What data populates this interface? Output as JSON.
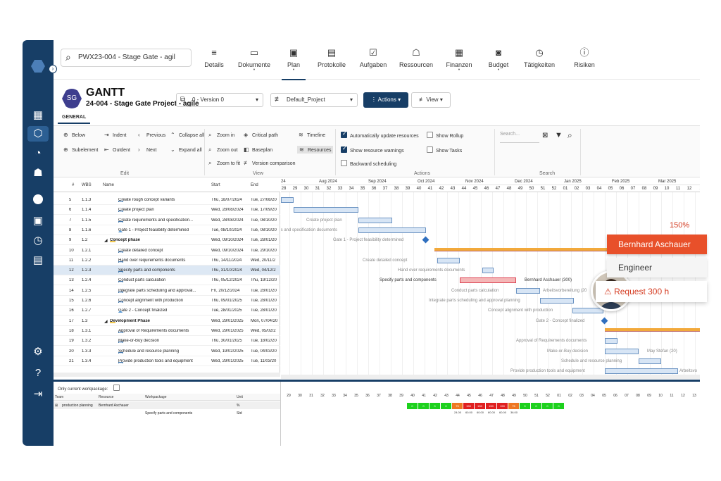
{
  "topnav": {
    "search_value": "PWX23-004 - Stage Gate - agil",
    "items": [
      {
        "label": "Details",
        "icon": "details-icon"
      },
      {
        "label": "Dokumente",
        "icon": "document-icon"
      },
      {
        "label": "Plan",
        "icon": "plan-icon"
      },
      {
        "label": "Protokolle",
        "icon": "protocol-icon"
      },
      {
        "label": "Aufgaben",
        "icon": "task-icon"
      },
      {
        "label": "Ressourcen",
        "icon": "resource-icon"
      },
      {
        "label": "Finanzen",
        "icon": "finance-icon"
      },
      {
        "label": "Budget",
        "icon": "budget-icon"
      },
      {
        "label": "Tätigkeiten",
        "icon": "timer-icon"
      },
      {
        "label": "Risiken",
        "icon": "risk-icon"
      }
    ]
  },
  "header": {
    "badge": "SG",
    "title": "GANTT",
    "subtitle": "24-004 - Stage Gate Project - agile",
    "version": "0 - Version 0",
    "profile": "Default_Project",
    "actions_label": "Actions",
    "view_label": "View",
    "tab": "GENERAL"
  },
  "ribbon": {
    "edit": {
      "below": "Below",
      "indent": "Indent",
      "subelement": "Subelement",
      "outdent": "Outdent",
      "previous": "Previous",
      "next": "Next",
      "collapse_all": "Collapse all",
      "expand_all": "Expand all",
      "group": "Edit"
    },
    "view": {
      "zoom_in": "Zoom in",
      "zoom_out": "Zoom out",
      "zoom_fit": "Zoom to fit",
      "critical_path": "Critical path",
      "baseplan": "Baseplan",
      "version_comparison": "Version comparison",
      "timeline": "Timeline",
      "resources": "Resources",
      "group": "View"
    },
    "actions": {
      "auto_update": "Automatically update resources",
      "show_warnings": "Show resource warnings",
      "backward": "Backward scheduling",
      "show_rollup": "Show Rollup",
      "show_tasks": "Show Tasks",
      "group": "Actions"
    },
    "search": {
      "placeholder": "Search...",
      "group": "Search"
    }
  },
  "grid": {
    "headers": {
      "num": "#",
      "wbs": "WBS",
      "name": "Name",
      "start": "Start",
      "end": "End"
    },
    "rows": [
      {
        "num": "5",
        "wbs": "1.1.3",
        "name": "Create rough concept variants",
        "start": "Thu, 18/07/2024",
        "end": "Tue, 27/08/20"
      },
      {
        "num": "6",
        "wbs": "1.1.4",
        "name": "Create project plan",
        "start": "Wed, 28/08/2024",
        "end": "Tue, 17/09/20"
      },
      {
        "num": "7",
        "wbs": "1.1.5",
        "name": "Create requirements and specification...",
        "start": "Wed, 28/08/2024",
        "end": "Tue, 08/10/20"
      },
      {
        "num": "8",
        "wbs": "1.1.6",
        "name": "Gate 1 - Project feasibility determined",
        "start": "Tue, 08/10/2024",
        "end": "Tue, 08/10/20"
      },
      {
        "num": "9",
        "wbs": "1.2",
        "name": "Concept phase",
        "start": "Wed, 09/10/2024",
        "end": "Tue, 28/01/20"
      },
      {
        "num": "10",
        "wbs": "1.2.1",
        "name": "Create detailed concept",
        "start": "Wed, 09/10/2024",
        "end": "Tue, 29/10/20"
      },
      {
        "num": "11",
        "wbs": "1.2.2",
        "name": "Hand over requirements documents",
        "start": "Thu, 14/11/2024",
        "end": "Wed, 20/11/2"
      },
      {
        "num": "12",
        "wbs": "1.2.3",
        "name": "Specify parts and components",
        "start": "Thu, 31/10/2024",
        "end": "Wed, 04/12/2"
      },
      {
        "num": "13",
        "wbs": "1.2.4",
        "name": "Conduct parts calculation",
        "start": "Thu, 05/12/2024",
        "end": "Thu, 19/12/20"
      },
      {
        "num": "14",
        "wbs": "1.2.5",
        "name": "Integrate parts scheduling and approval...",
        "start": "Fri, 20/12/2024",
        "end": "Tue, 28/01/20"
      },
      {
        "num": "15",
        "wbs": "1.2.6",
        "name": "Concept alignment with production",
        "start": "Thu, 09/01/2025",
        "end": "Tue, 28/01/20"
      },
      {
        "num": "16",
        "wbs": "1.2.7",
        "name": "Gate 2 - Concept finalized",
        "start": "Tue, 28/01/2025",
        "end": "Tue, 28/01/20"
      },
      {
        "num": "17",
        "wbs": "1.3",
        "name": "Development Phase",
        "start": "Wed, 29/01/2025",
        "end": "Mon, 07/04/20"
      },
      {
        "num": "18",
        "wbs": "1.3.1",
        "name": "Approval of Requirements documents",
        "start": "Wed, 29/01/2025",
        "end": "Wed, 05/02/2"
      },
      {
        "num": "19",
        "wbs": "1.3.2",
        "name": "Make-or-Buy decision",
        "start": "Thu, 30/01/2025",
        "end": "Tue, 18/02/20"
      },
      {
        "num": "20",
        "wbs": "1.3.3",
        "name": "Schedule and resource planning",
        "start": "Wed, 19/02/2025",
        "end": "Tue, 04/03/20"
      },
      {
        "num": "21",
        "wbs": "1.3.4",
        "name": "Provide production tools and equipment",
        "start": "Wed, 29/01/2025",
        "end": "Tue, 11/03/20"
      }
    ]
  },
  "timeline": {
    "months": [
      "24",
      "Aug 2024",
      "Sep 2024",
      "Oct 2024",
      "Nov 2024",
      "Dec 2024",
      "Jan 2025",
      "Feb 2025",
      "Mar 2025"
    ],
    "weeks": [
      "28",
      "29",
      "30",
      "31",
      "32",
      "33",
      "34",
      "35",
      "36",
      "37",
      "38",
      "39",
      "40",
      "41",
      "42",
      "43",
      "44",
      "45",
      "46",
      "47",
      "48",
      "49",
      "50",
      "51",
      "52",
      "01",
      "02",
      "03",
      "04",
      "05",
      "06",
      "07",
      "08",
      "09",
      "10",
      "11",
      "12",
      "1"
    ],
    "labels": {
      "l6": "Create project plan",
      "l7": "ts and specification documents",
      "l8": "Gate 1 - Project feasibility determined",
      "l10": "Create detailed concept",
      "l11": "Hand over requirements documents",
      "l12a": "Specify parts and components",
      "l12b": "Bernhard Aschauer (300)",
      "l13": "Conduct parts calculation",
      "l13b": "Arbeitsvorbereitung (20",
      "l14": "Integrate parts scheduling and approval planning",
      "l15": "Concept alignment with production",
      "l16": "Gate 2 - Concept finalized",
      "l18": "Approval of Requirements documents",
      "l19": "Make-or-Buy decision",
      "l19b": "May Stefan (20)",
      "l20": "Schedule and resource planning",
      "l21": "Provide production tools and equipment",
      "l21b": "Arbeitsvo"
    }
  },
  "resource_panel": {
    "only_current": "Only current workpackage:",
    "headers": {
      "team": "Team",
      "resource": "Resource",
      "workpackage": "Workpackage",
      "unit": "Unit"
    },
    "row1": {
      "team": "production planning",
      "resource": "Bernhard Aschauer",
      "unit": "%"
    },
    "row2": {
      "workpackage": "Specify parts and components",
      "unit": "Std"
    },
    "weeks": [
      "29",
      "30",
      "31",
      "32",
      "33",
      "34",
      "35",
      "36",
      "37",
      "38",
      "39",
      "40",
      "41",
      "42",
      "43",
      "44",
      "45",
      "46",
      "47",
      "48",
      "49",
      "50",
      "51",
      "52",
      "01",
      "02",
      "03",
      "04",
      "05",
      "06",
      "07",
      "08",
      "09",
      "10",
      "11",
      "12",
      "13"
    ],
    "cell_values": [
      "0",
      "0",
      "0",
      "0",
      "75",
      "150",
      "150",
      "150",
      "150",
      "75",
      "0",
      "0",
      "0",
      "0"
    ],
    "hours": [
      "24.00",
      "60.00",
      "60.00",
      "60.00",
      "60.00",
      "36.00"
    ]
  },
  "overlay": {
    "percent": "150%",
    "name": "Bernhard Aschauer",
    "role": "Engineer",
    "request": "Request 300 h"
  },
  "colors": {
    "sidebar": "#173e66",
    "accent_orange": "#e8502a",
    "warning_red": "#d53c22"
  }
}
